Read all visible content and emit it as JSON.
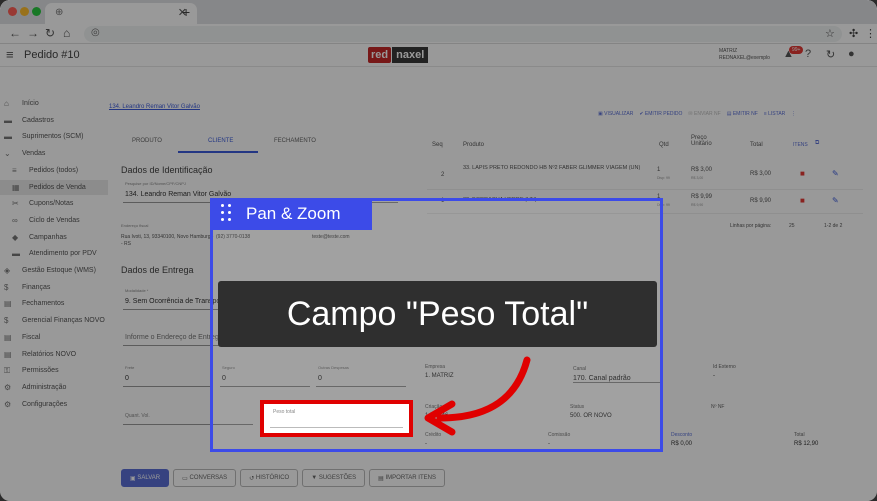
{
  "browser": {
    "tab_fav": "⊕",
    "tab_close": "✕",
    "new_tab": "+"
  },
  "app": {
    "title": "Pedido #10",
    "logo_red": "red",
    "logo_rest": "naxel",
    "account_line1": "MATRIZ",
    "account_line2": "REDNAXEL@exemplo",
    "notif_count": "99+"
  },
  "sidebar": [
    {
      "icon": "⌂",
      "label": "Início",
      "sub": false
    },
    {
      "icon": "▬",
      "label": "Cadastros",
      "sub": false
    },
    {
      "icon": "▬",
      "label": "Suprimentos (SCM)",
      "sub": false
    },
    {
      "icon": "⌄",
      "label": "Vendas",
      "sub": false
    },
    {
      "icon": "≡",
      "label": "Pedidos (todos)",
      "sub": true
    },
    {
      "icon": "▦",
      "label": "Pedidos de Venda",
      "sub": true,
      "active": true
    },
    {
      "icon": "✂",
      "label": "Cupons/Notas",
      "sub": true
    },
    {
      "icon": "∞",
      "label": "Ciclo de Vendas",
      "sub": true
    },
    {
      "icon": "◆",
      "label": "Campanhas",
      "sub": true
    },
    {
      "icon": "▬",
      "label": "Atendimento por PDV",
      "sub": true
    },
    {
      "icon": "◈",
      "label": "Gestão Estoque (WMS)",
      "sub": false
    },
    {
      "icon": "$",
      "label": "Finanças",
      "sub": false
    },
    {
      "icon": "▤",
      "label": "Fechamentos",
      "sub": false
    },
    {
      "icon": "$",
      "label": "Gerencial Finanças NOVO",
      "sub": false
    },
    {
      "icon": "▤",
      "label": "Fiscal",
      "sub": false
    },
    {
      "icon": "▤",
      "label": "Relatórios NOVO",
      "sub": false
    },
    {
      "icon": "⚿",
      "label": "Permissões",
      "sub": false
    },
    {
      "icon": "⚙",
      "label": "Administração",
      "sub": false
    },
    {
      "icon": "⚙",
      "label": "Configurações",
      "sub": false
    }
  ],
  "client_link": "134. Leandro Reman Vitor Galvão",
  "actions": [
    "VISUALIZAR",
    "EMITIR PEDIDO",
    "ENVIAR NF",
    "EMITIR NF",
    "LISTAR"
  ],
  "tabs": [
    "PRODUTO",
    "CLIENTE",
    "FECHAMENTO"
  ],
  "ident": {
    "heading": "Dados de Identificação",
    "search_label": "Pesquise por ID/Nome/CPF/CNPJ",
    "search_value": "134. Leandro Reman Vitor Galvão",
    "addr_label": "Endereço fiscal",
    "address": "Rua Ivoti, 13, 93340100, Novo Hamburgo - RS",
    "phone": "(92) 3770-0138",
    "email": "teste@teste.com"
  },
  "delivery": {
    "heading": "Dados de Entrega",
    "mod_label": "Modalidade *",
    "mod_value": "9. Sem Ocorrência de Transporte",
    "addr_placeholder": "Informe o Endereço de Entrega"
  },
  "costs": {
    "frete_label": "Frete",
    "frete_value": "0",
    "seguro_label": "Seguro",
    "seguro_value": "0",
    "outras_label": "Outras Despesas",
    "outras_value": "0",
    "quant_vol": "Quant. Vol.",
    "peso_total": "Peso total"
  },
  "table": {
    "headers": [
      "Seq",
      "Produto",
      "Qtd",
      "Preço Unitário",
      "Total",
      "ITENS"
    ],
    "rows": [
      {
        "seq": "2",
        "product": "33. LAPIS PRETO REDONDO HB Nº2 FABER GLIMMER VIAGEM (UN)",
        "qtd": "1",
        "qtd_sub": "Disp: 99",
        "price": "R$ 3,00",
        "price_sub": "R$ 3,00",
        "total": "R$ 3,00"
      },
      {
        "seq": "1",
        "product": "32. BORRACHA VERDE (UN)",
        "qtd": "1",
        "qtd_sub": "Disp: 99",
        "price": "R$ 9,99",
        "price_sub": "R$ 9,90",
        "total": "R$ 9,90"
      }
    ],
    "pagination_label": "Linhas por página:",
    "page_size": "25",
    "range": "1-2 de 2"
  },
  "info": {
    "empresa_label": "Empresa",
    "empresa_value": "1. MATRIZ",
    "canal_label": "Canal",
    "canal_value": "170. Canal padrão",
    "id_externo_label": "Id Externo",
    "id_externo_value": "-",
    "criacao_label": "Criação",
    "criacao_value": "14:42:46",
    "status_label": "Status",
    "status_value": "500. OR NOVO",
    "nfe_label": "Nº NF",
    "credito_label": "Crédito",
    "credito_value": "-",
    "comissao_label": "Comissão",
    "comissao_value": "-",
    "subtotal_value": "R$ 0,00",
    "desconto_label": "Desconto",
    "desconto_value": "R$ 0,00",
    "total_label": "Total",
    "total_value": "R$ 12,90"
  },
  "bottom_buttons": [
    "SALVAR",
    "CONVERSAS",
    "HISTÓRICO",
    "SUGESTÕES",
    "IMPORTAR ITENS"
  ],
  "overlay": {
    "badge": "Pan & Zoom",
    "callout": "Campo \"Peso Total\"",
    "accent": "#3c4be8",
    "highlight": "#e00000"
  }
}
